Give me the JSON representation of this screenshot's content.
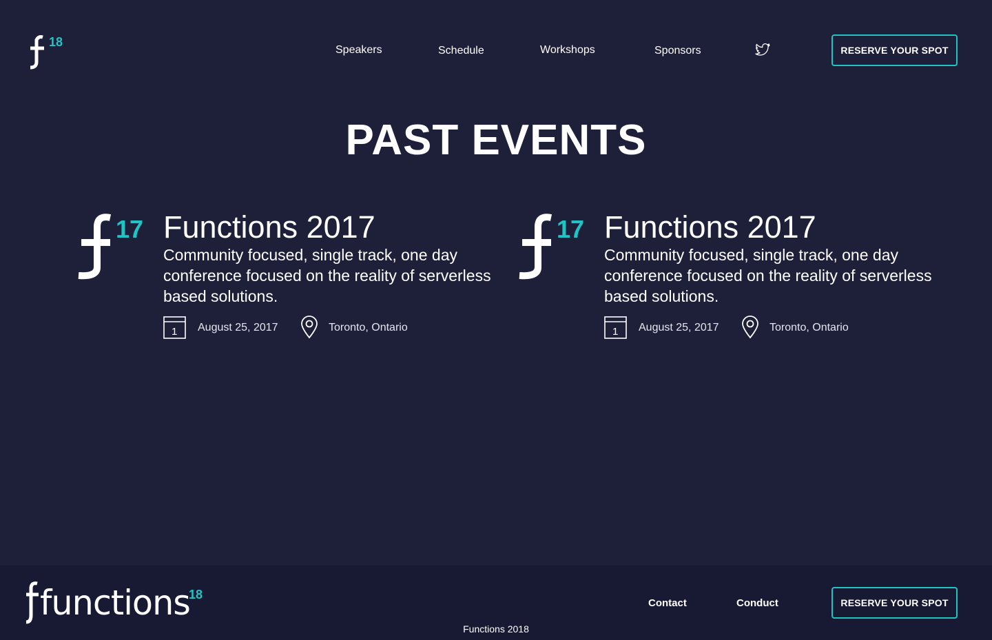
{
  "header": {
    "logo_badge": "18",
    "nav": [
      {
        "label": "Speakers"
      },
      {
        "label": "Schedule"
      },
      {
        "label": "Workshops"
      },
      {
        "label": "Sponsors"
      }
    ],
    "twitter_icon": "twitter-icon",
    "cta_label": "RESERVE YOUR SPOT"
  },
  "page": {
    "title": "PAST EVENTS"
  },
  "events": [
    {
      "logo_badge": "17",
      "title": "Functions 2017",
      "description": "Community focused, single track, one day conference focused on the reality of serverless based solutions.",
      "date_icon": "calendar-icon",
      "calendar_day": "1",
      "date": "August 25, 2017",
      "location_icon": "map-pin-icon",
      "location": "Toronto, Ontario"
    },
    {
      "logo_badge": "17",
      "title": "Functions 2017",
      "description": "Community focused, single track, one day conference focused on the reality of serverless based solutions.",
      "date_icon": "calendar-icon",
      "calendar_day": "1",
      "date": "August 25, 2017",
      "location_icon": "map-pin-icon",
      "location": "Toronto, Ontario"
    }
  ],
  "footer": {
    "logo_text": "functions",
    "logo_badge": "18",
    "links": [
      {
        "label": "Contact"
      },
      {
        "label": "Conduct"
      }
    ],
    "cta_label": "RESERVE YOUR SPOT",
    "copyright": "Functions 2018"
  },
  "colors": {
    "background": "#1e1f39",
    "footer_background": "#181a34",
    "accent": "#20c4c4",
    "text": "#ffffff"
  }
}
